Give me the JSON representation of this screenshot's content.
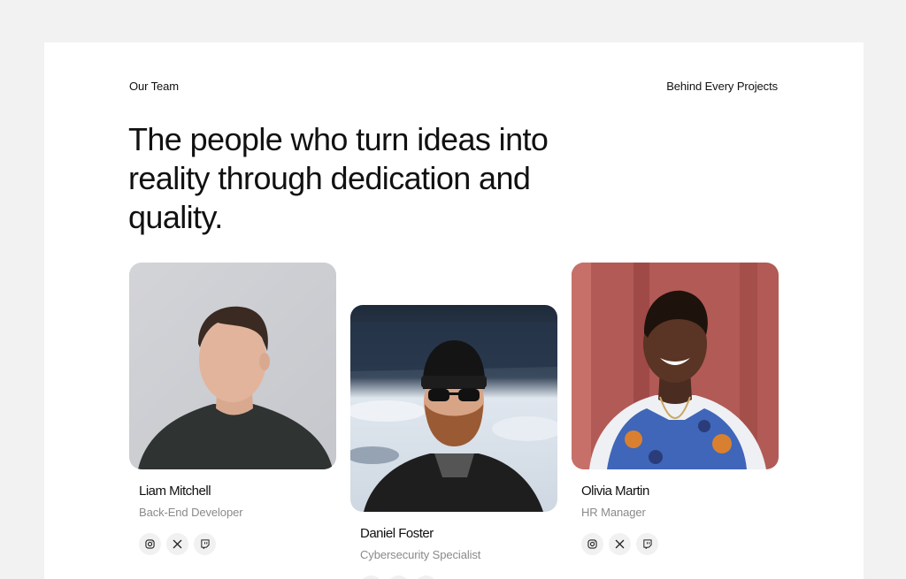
{
  "section": {
    "eyebrow": "Our Team",
    "tagline": "Behind Every Projects",
    "headline": "The people who turn ideas into reality through dedication and quality."
  },
  "team": [
    {
      "name": "Liam Mitchell",
      "role": "Back-End Developer",
      "socials": [
        "instagram-icon",
        "x-icon",
        "twitch-icon"
      ]
    },
    {
      "name": "Daniel Foster",
      "role": "Cybersecurity Specialist",
      "socials": [
        "instagram-icon",
        "x-icon",
        "twitch-icon"
      ]
    },
    {
      "name": "Olivia Martin",
      "role": "HR Manager",
      "socials": [
        "instagram-icon",
        "x-icon",
        "twitch-icon"
      ]
    }
  ],
  "colors": {
    "page_background": "#f2f2f2",
    "panel_background": "#ffffff",
    "text_primary": "#111111",
    "text_secondary": "#8a8a8a",
    "social_bg": "#f1f1f1"
  }
}
